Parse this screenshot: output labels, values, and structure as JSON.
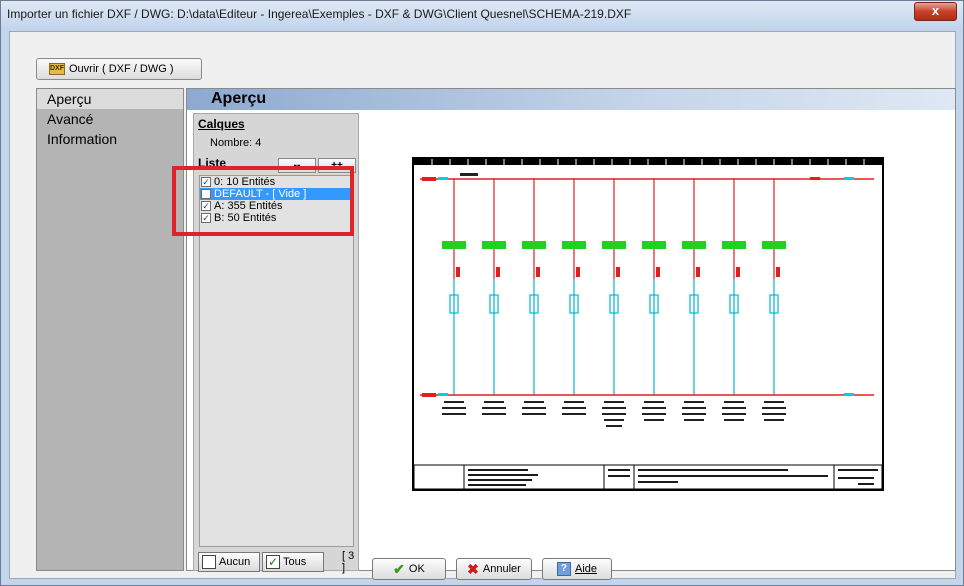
{
  "window": {
    "title": "Importer un fichier DXF / DWG: D:\\data\\Editeur - Ingerea\\Exemples - DXF & DWG\\Client Quesnel\\SCHEMA-219.DXF",
    "close_label": "x"
  },
  "toolbar": {
    "open_label": "Ouvrir ( DXF / DWG )",
    "open_icon": "dxf-file-icon"
  },
  "nav": {
    "items": [
      "Aperçu",
      "Avancé",
      "Information"
    ],
    "selected": "Aperçu"
  },
  "page": {
    "header": "Aperçu"
  },
  "layers": {
    "section_title": "Calques",
    "count_label": "Nombre: 4",
    "list_title": "Liste",
    "collapse_label": "--",
    "expand_label": "++",
    "items": [
      {
        "label": "0: 10 Entités",
        "checked": true,
        "selected": false
      },
      {
        "label": "DEFAULT - [ Vide ]",
        "checked": false,
        "selected": true
      },
      {
        "label": "A: 355 Entités",
        "checked": true,
        "selected": false
      },
      {
        "label": "B: 50 Entités",
        "checked": true,
        "selected": false
      }
    ],
    "none_label": "Aucun",
    "all_label": "Tous",
    "checked_count": "[ 3 ]"
  },
  "footer": {
    "ok_label": "OK",
    "cancel_label": "Annuler",
    "help_label": "Aide"
  },
  "colors": {
    "highlight_box": "#e0222a",
    "selection": "#3399ff",
    "title_bg": "#c4d6ec"
  }
}
